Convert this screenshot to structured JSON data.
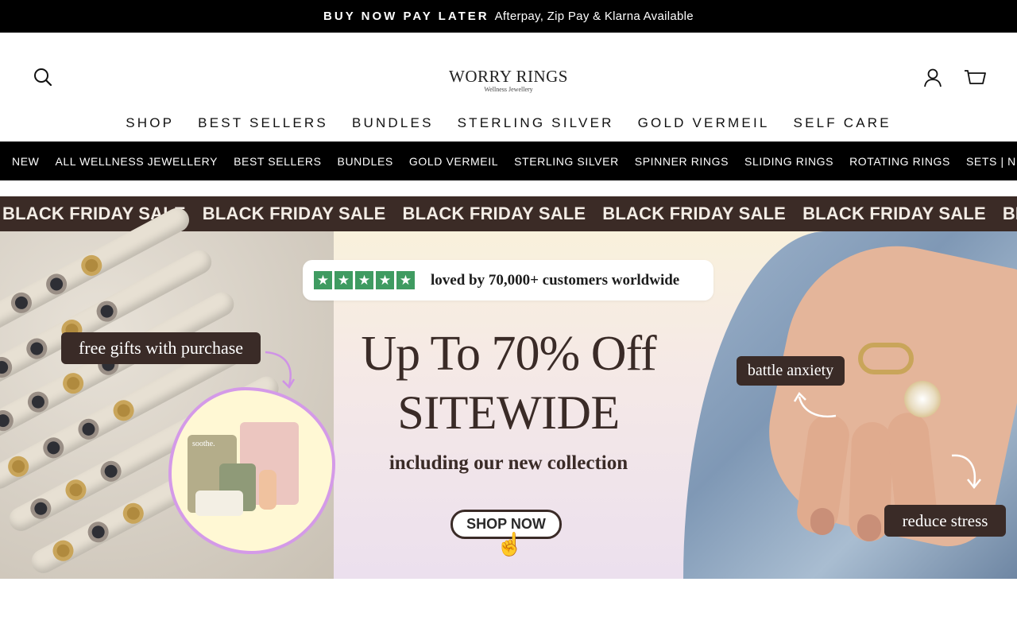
{
  "announcement": {
    "bold": "BUY NOW PAY LATER",
    "text": "Afterpay, Zip Pay & Klarna Available"
  },
  "header": {
    "logo_title": "WORRY RINGS",
    "logo_subtitle": "Wellness Jewellery",
    "icons": {
      "search": "search-icon",
      "account": "account-icon",
      "cart": "cart-icon"
    }
  },
  "main_nav": [
    "SHOP",
    "BEST SELLERS",
    "BUNDLES",
    "STERLING SILVER",
    "GOLD VERMEIL",
    "SELF CARE"
  ],
  "sub_nav": [
    "NEW",
    "ALL WELLNESS JEWELLERY",
    "BEST SELLERS",
    "BUNDLES",
    "GOLD VERMEIL",
    "STERLING SILVER",
    "SPINNER RINGS",
    "SLIDING RINGS",
    "ROTATING RINGS",
    "SETS | NECKLACES |"
  ],
  "hero": {
    "sale_strip": [
      "BLACK FRIDAY SALE",
      "BLACK FRIDAY SALE",
      "BLACK FRIDAY SALE",
      "BLACK FRIDAY SALE",
      "BLACK FRIDAY SALE",
      "BLACK FRIDAY SALE"
    ],
    "trust_text": "loved by 70,000+ customers worldwide",
    "headline_line1": "Up To 70% Off",
    "headline_line2": "SITEWIDE",
    "subline": "including our new collection",
    "cta": "SHOP NOW",
    "badge_free_gifts": "free gifts with purchase",
    "badge_anxiety": "battle anxiety",
    "badge_stress": "reduce stress",
    "gift_box_label": "soothe.",
    "colors": {
      "strip": "#3b2b26",
      "stars": "#3f9b61",
      "badge": "#3a2b27",
      "blob_border": "#d49ae8"
    }
  }
}
